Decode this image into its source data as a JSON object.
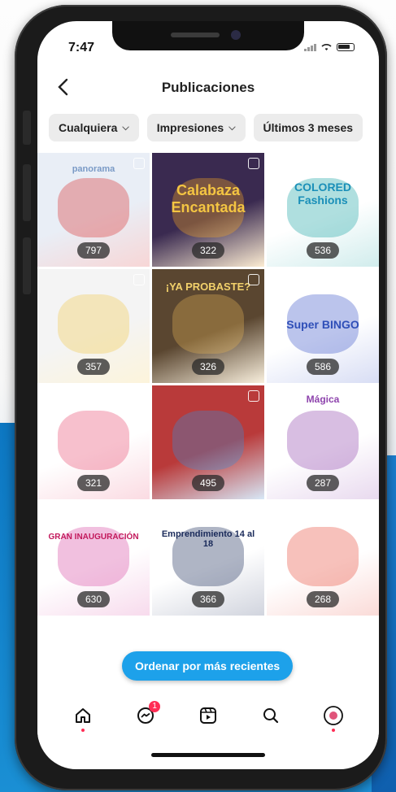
{
  "status": {
    "time": "7:47"
  },
  "header": {
    "title": "Publicaciones"
  },
  "filters": [
    {
      "label": "Cualquiera",
      "chevron": "⌵"
    },
    {
      "label": "Impresiones",
      "chevron": "⌵"
    },
    {
      "label": "Últimos 3 meses",
      "chevron": ""
    }
  ],
  "posts": [
    {
      "count": "797",
      "art": "panorama",
      "bg": "#e9eef6"
    },
    {
      "count": "322",
      "art": "Calabaza Encantada",
      "bg": "#3a2a50"
    },
    {
      "count": "536",
      "art": "COLORED Fashions",
      "bg": "#ffffff"
    },
    {
      "count": "357",
      "art": "",
      "bg": "#f4f4f4"
    },
    {
      "count": "326",
      "art": "¡YA PROBASTE?",
      "bg": "#5a4630"
    },
    {
      "count": "586",
      "art": "Super BINGO",
      "bg": "#ffffff"
    },
    {
      "count": "321",
      "art": "",
      "bg": "#ffffff"
    },
    {
      "count": "495",
      "art": "",
      "bg": "#b93a3a"
    },
    {
      "count": "287",
      "art": "Mágica",
      "bg": "#ffffff"
    },
    {
      "count": "630",
      "art": "GRAN INAUGURACIÓN",
      "bg": "#ffffff"
    },
    {
      "count": "366",
      "art": "Emprendimiento 14 al 18",
      "bg": "#ffffff"
    },
    {
      "count": "268",
      "art": "",
      "bg": "#ffffff"
    },
    {
      "count": "",
      "art": "",
      "bg": "#6e9ab8"
    },
    {
      "count": "",
      "art": "",
      "bg": "#9b5a4a"
    },
    {
      "count": "",
      "art": "",
      "bg": "#f0c6cc"
    }
  ],
  "sort_button": {
    "label": "Ordenar por más recientes"
  },
  "tabbar": {
    "messages_badge": "1"
  }
}
